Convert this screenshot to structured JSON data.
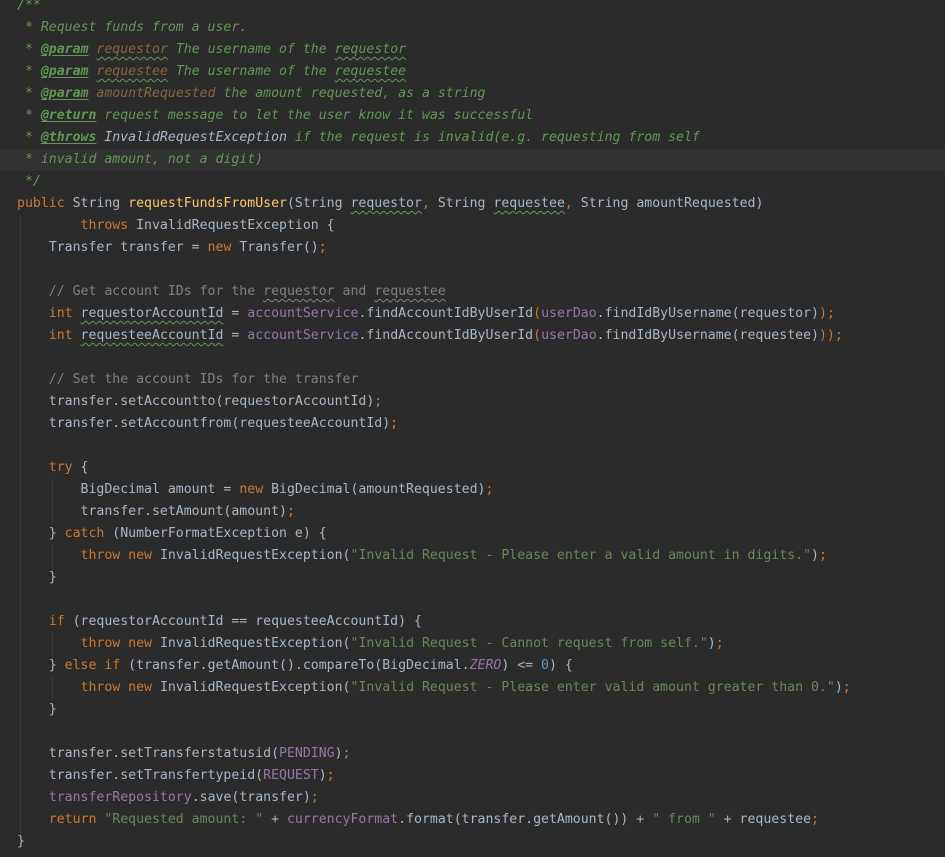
{
  "editor": {
    "language": "Java",
    "theme_colors": {
      "background": "#2b2b2b",
      "current_line": "#323232",
      "keyword": "#cc7832",
      "method": "#ffc66d",
      "field": "#9876aa",
      "string": "#6a8759",
      "comment": "#808080",
      "doc": "#629755",
      "number": "#6897bb"
    },
    "lines": [
      [
        [
          "doc",
          "/**"
        ]
      ],
      [
        [
          "doc",
          " * Request funds from a user."
        ]
      ],
      [
        [
          "doc",
          " * "
        ],
        [
          "tag",
          "@param"
        ],
        [
          "doc",
          " "
        ],
        [
          "docparam_typo",
          "requestor"
        ],
        [
          "doc",
          " The username of the "
        ],
        [
          "doc_typo",
          "requestor"
        ]
      ],
      [
        [
          "doc",
          " * "
        ],
        [
          "tag",
          "@param"
        ],
        [
          "doc",
          " "
        ],
        [
          "docparam_typo",
          "requestee"
        ],
        [
          "doc",
          " The username of the "
        ],
        [
          "doc_typo",
          "requestee"
        ]
      ],
      [
        [
          "doc",
          " * "
        ],
        [
          "tag",
          "@param"
        ],
        [
          "doc",
          " "
        ],
        [
          "docparam",
          "amountRequested"
        ],
        [
          "doc",
          " the amount requested, as a string"
        ]
      ],
      [
        [
          "doc",
          " * "
        ],
        [
          "tag",
          "@return"
        ],
        [
          "doc",
          " request message to let the user know it was successful"
        ]
      ],
      [
        [
          "doc",
          " * "
        ],
        [
          "tag",
          "@throws"
        ],
        [
          "doc",
          " "
        ],
        [
          "doccode",
          "InvalidRequestException"
        ],
        [
          "doc",
          " if the request is invalid(e.g. requesting from self"
        ]
      ],
      [
        [
          "doc",
          " * invalid amount, not a digit)"
        ]
      ],
      [
        [
          "doc",
          " */"
        ]
      ],
      [
        [
          "kw",
          "public "
        ],
        [
          "plain",
          "String "
        ],
        [
          "method",
          "requestFundsFromUser"
        ],
        [
          "plain",
          "(String "
        ],
        [
          "plain_typo",
          "requestor"
        ],
        [
          "punct",
          ", "
        ],
        [
          "plain",
          "String "
        ],
        [
          "plain_typo",
          "requestee"
        ],
        [
          "punct",
          ", "
        ],
        [
          "plain",
          "String amountRequested)"
        ]
      ],
      [
        [
          "plain",
          "        "
        ],
        [
          "kw",
          "throws "
        ],
        [
          "plain",
          "InvalidRequestException {"
        ]
      ],
      [
        [
          "plain",
          "    Transfer transfer = "
        ],
        [
          "kw",
          "new "
        ],
        [
          "plain",
          "Transfer()"
        ],
        [
          "punct",
          ";"
        ]
      ],
      [],
      [
        [
          "comment",
          "    // Get account IDs for the "
        ],
        [
          "comment_typo",
          "requestor"
        ],
        [
          "comment",
          " and "
        ],
        [
          "comment_typo",
          "requestee"
        ]
      ],
      [
        [
          "plain",
          "    "
        ],
        [
          "kw",
          "int "
        ],
        [
          "plain_typo",
          "requestorAccountId"
        ],
        [
          "plain",
          " = "
        ],
        [
          "field",
          "accountService"
        ],
        [
          "plain",
          ".findAccountIdByUserId"
        ],
        [
          "punct",
          "("
        ],
        [
          "field",
          "userDao"
        ],
        [
          "plain",
          ".findIdByUsername(requestor)"
        ],
        [
          "punct",
          ");"
        ]
      ],
      [
        [
          "plain",
          "    "
        ],
        [
          "kw",
          "int "
        ],
        [
          "plain_typo",
          "requesteeAccountId"
        ],
        [
          "plain",
          " = "
        ],
        [
          "field",
          "accountService"
        ],
        [
          "plain",
          ".findAccountIdByUserId"
        ],
        [
          "punct",
          "("
        ],
        [
          "field",
          "userDao"
        ],
        [
          "plain",
          ".findIdByUsername(requestee)"
        ],
        [
          "punct",
          "));"
        ]
      ],
      [],
      [
        [
          "comment",
          "    // Set the account IDs for the transfer"
        ]
      ],
      [
        [
          "plain",
          "    transfer.setAccountto(requestorAccountId)"
        ],
        [
          "punct",
          ";"
        ]
      ],
      [
        [
          "plain",
          "    transfer.setAccountfrom(requesteeAccountId)"
        ],
        [
          "punct",
          ";"
        ]
      ],
      [],
      [
        [
          "plain",
          "    "
        ],
        [
          "kw",
          "try "
        ],
        [
          "plain",
          "{"
        ]
      ],
      [
        [
          "plain",
          "        BigDecimal amount = "
        ],
        [
          "kw",
          "new "
        ],
        [
          "plain",
          "BigDecimal(amountRequested)"
        ],
        [
          "punct",
          ";"
        ]
      ],
      [
        [
          "plain",
          "        transfer.setAmount(amount)"
        ],
        [
          "punct",
          ";"
        ]
      ],
      [
        [
          "plain",
          "    } "
        ],
        [
          "kw",
          "catch "
        ],
        [
          "plain",
          "(NumberFormatException e) {"
        ]
      ],
      [
        [
          "plain",
          "        "
        ],
        [
          "kw",
          "throw new "
        ],
        [
          "plain",
          "InvalidRequestException("
        ],
        [
          "str",
          "\"Invalid Request - Please enter a valid amount in digits.\""
        ],
        [
          "plain",
          ")"
        ],
        [
          "punct",
          ";"
        ]
      ],
      [
        [
          "plain",
          "    }"
        ]
      ],
      [],
      [
        [
          "plain",
          "    "
        ],
        [
          "kw",
          "if "
        ],
        [
          "plain",
          "(requestorAccountId == requesteeAccountId) {"
        ]
      ],
      [
        [
          "plain",
          "        "
        ],
        [
          "kw",
          "throw new "
        ],
        [
          "plain",
          "InvalidRequestException("
        ],
        [
          "str",
          "\"Invalid Request - Cannot request from self.\""
        ],
        [
          "plain",
          ")"
        ],
        [
          "punct",
          ";"
        ]
      ],
      [
        [
          "plain",
          "    } "
        ],
        [
          "kw",
          "else if "
        ],
        [
          "plain",
          "(transfer.getAmount().compareTo(BigDecimal."
        ],
        [
          "static",
          "ZERO"
        ],
        [
          "plain",
          ") <= "
        ],
        [
          "num",
          "0"
        ],
        [
          "plain",
          ") {"
        ]
      ],
      [
        [
          "plain",
          "        "
        ],
        [
          "kw",
          "throw new "
        ],
        [
          "plain",
          "InvalidRequestException("
        ],
        [
          "str",
          "\"Invalid Request - Please enter valid amount greater than 0.\""
        ],
        [
          "plain",
          ")"
        ],
        [
          "punct",
          ";"
        ]
      ],
      [
        [
          "plain",
          "    }"
        ]
      ],
      [],
      [
        [
          "plain",
          "    transfer.setTransferstatusid("
        ],
        [
          "field",
          "PENDING"
        ],
        [
          "plain",
          ")"
        ],
        [
          "punct",
          ";"
        ]
      ],
      [
        [
          "plain",
          "    transfer.setTransfertypeid("
        ],
        [
          "field",
          "REQUEST"
        ],
        [
          "plain",
          ")"
        ],
        [
          "punct",
          ";"
        ]
      ],
      [
        [
          "plain",
          "    "
        ],
        [
          "field",
          "transferRepository"
        ],
        [
          "plain",
          ".save(transfer)"
        ],
        [
          "punct",
          ";"
        ]
      ],
      [
        [
          "plain",
          "    "
        ],
        [
          "kw",
          "return "
        ],
        [
          "str",
          "\"Requested amount: \""
        ],
        [
          "plain",
          " + "
        ],
        [
          "field",
          "currencyFormat"
        ],
        [
          "plain",
          ".format(transfer.getAmount()) + "
        ],
        [
          "str",
          "\" from \""
        ],
        [
          "plain",
          " + requestee"
        ],
        [
          "punct",
          ";"
        ]
      ],
      [
        [
          "plain",
          "}"
        ]
      ]
    ]
  }
}
